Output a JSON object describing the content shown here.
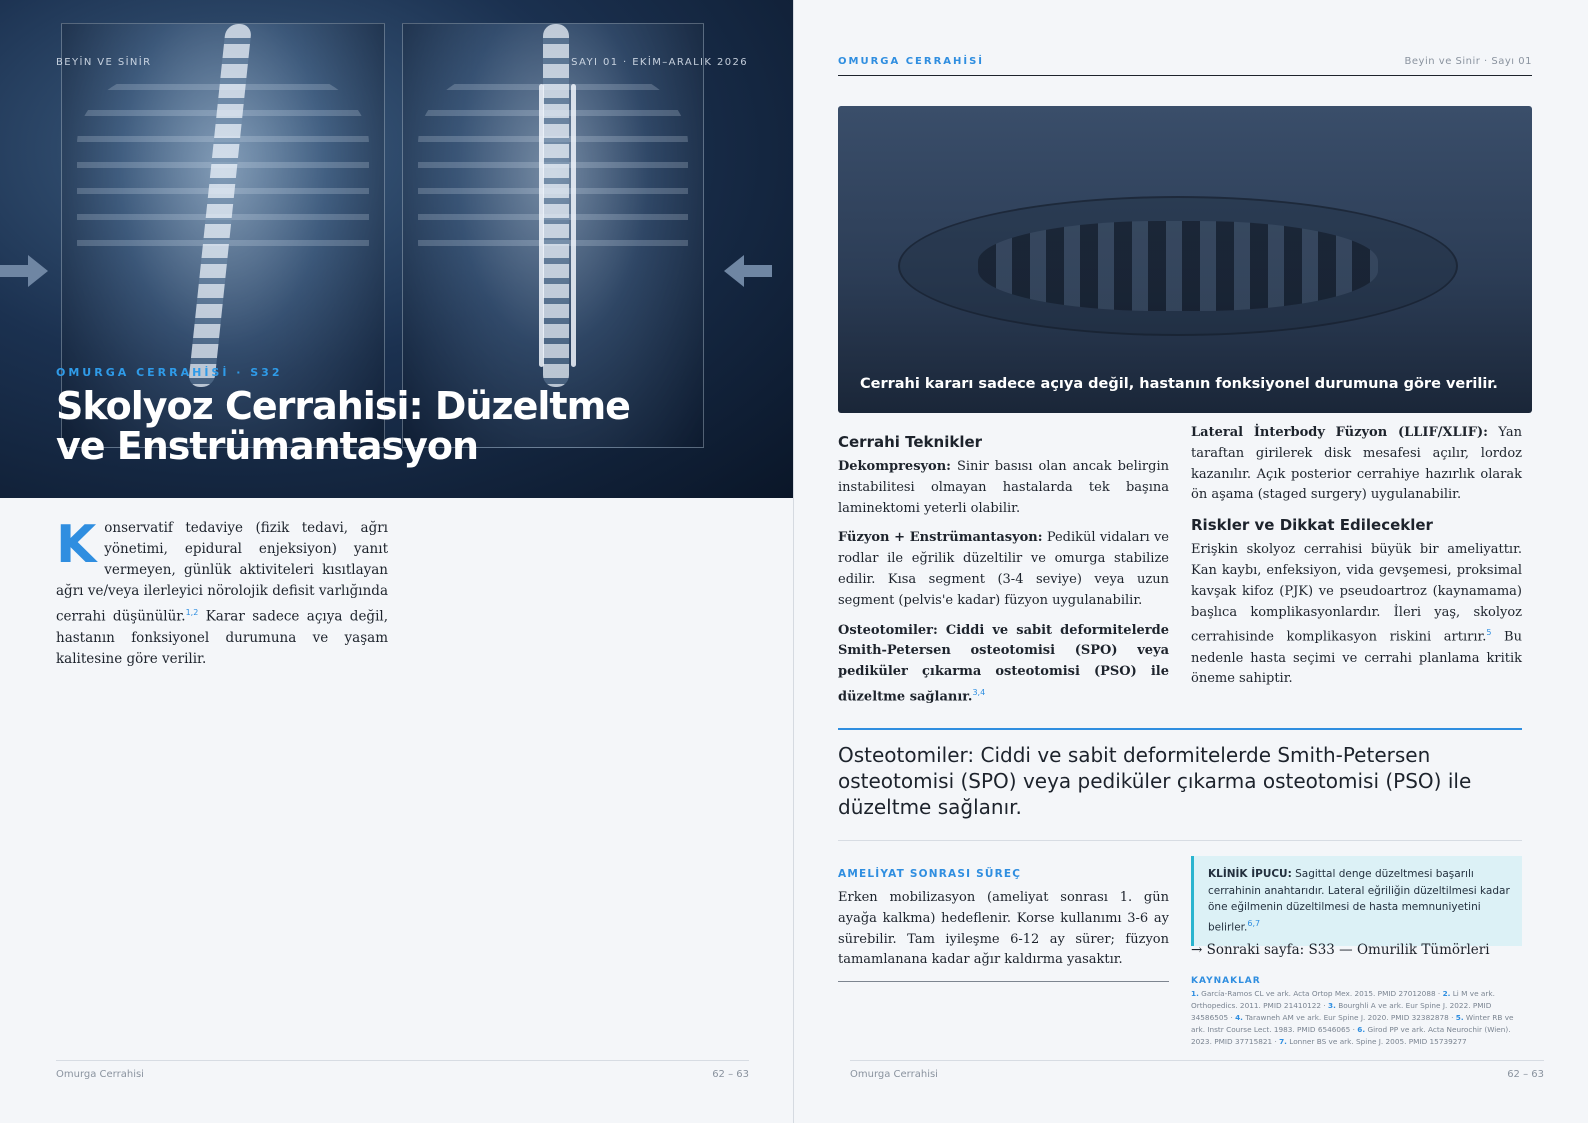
{
  "left": {
    "running_left": "BEYİN VE SİNİR",
    "running_right": "SAYI 01 · EKİM–ARALIK 2026",
    "kicker": "OMURGA CERRAHİSİ · S32",
    "title_line1": "Skolyoz Cerrahisi: Düzeltme",
    "title_line2": "ve Enstrümantasyon",
    "dropcap": "K",
    "intro_a": "onservatif tedaviye (fizik tedavi, ağrı yönetimi, epidural enjeksiyon) yanıt vermeyen, günlük aktiviteleri kısıtlayan ağrı ve/veya ilerleyici nörolojik defisit varlığında cerrahi düşünülür.",
    "intro_sup": "1,2",
    "intro_b": " Karar sadece açıya değil, hastanın fonksiyonel durumuna ve yaşam kalitesine göre verilir.",
    "footer_left": "Omurga Cerrahisi",
    "footer_right": "62 – 63"
  },
  "right": {
    "header_section": "OMURGA CERRAHİSİ",
    "header_mag": "Beyin ve Sinir · Sayı 01",
    "figure_caption": "Cerrahi kararı sadece açıya değil, hastanın fonksiyonel durumuna göre verilir.",
    "techniques_heading": "Cerrahi Teknikler",
    "decomp_label": "Dekompresyon:",
    "decomp_text": " Sinir basısı olan ancak belirgin instabilitesi olmayan hastalarda tek başına laminektomi yeterli olabilir.",
    "fusion_label": "Füzyon + Enstrümantasyon:",
    "fusion_text": " Pedikül vidaları ve rodlar ile eğrilik düzeltilir ve omurga stabilize edilir. Kısa segment (3-4 seviye) veya uzun segment (pelvis'e kadar) füzyon uygulanabilir.",
    "osteo_text": "Osteotomiler: Ciddi ve sabit deformitelerde Smith-Petersen osteotomisi (SPO) veya pediküler çıkarma osteotomisi (PSO) ile düzeltme sağlanır.",
    "osteo_sup": "3,4",
    "llif_label": "Lateral İnterbody Füzyon (LLIF/XLIF):",
    "llif_text": " Yan taraftan girilerek disk mesafesi açılır, lordoz kazanılır. Açık posterior cerrahiye hazırlık olarak ön aşama (staged surgery) uygulanabilir.",
    "risks_heading": "Riskler ve Dikkat Edilecekler",
    "risks_a": "Erişkin skolyoz cerrahisi büyük bir ameliyattır. Kan kaybı, enfeksiyon, vida gevşemesi, proksimal kavşak kifoz (PJK) ve pseudoartroz (kaynamama) başlıca komplikasyonlardır. İleri yaş, skolyoz cerrahisinde komplikasyon riskini artırır.",
    "risks_sup": "5",
    "risks_b": " Bu nedenle hasta seçimi ve cerrahi planlama kritik öneme sahiptir.",
    "pull_quote": "Osteotomiler: Ciddi ve sabit deformitelerde Smith-Petersen osteotomisi (SPO) veya pediküler çıkarma osteotomisi (PSO) ile düzeltme sağlanır.",
    "post_kicker": "AMELİYAT SONRASI SÜREÇ",
    "post_text": "Erken mobilizasyon (ameliyat sonrası 1. gün ayağa kalkma) hedeflenir. Korse kullanımı 3-6 ay sürebilir. Tam iyileşme 6-12 ay sürer; füzyon tamamlanana kadar ağır kaldırma yasaktır.",
    "tip_label": "KLİNİK İPUCU:",
    "tip_text": " Sagittal denge düzeltmesi başarılı cerrahinin anahtarıdır. Lateral eğriliğin düzeltilmesi kadar öne eğilmenin düzeltilmesi de hasta memnuniyetini belirler.",
    "tip_sup": "6,7",
    "next_page": "→ Sonraki sayfa: S33 — Omurilik Tümörleri",
    "refs_heading": "KAYNAKLAR",
    "refs": [
      {
        "n": "1.",
        "t": " García-Ramos CL ve ark. Acta Ortop Mex. 2015. PMID 27012088 · "
      },
      {
        "n": "2.",
        "t": " Li M ve ark. Orthopedics. 2011. PMID 21410122 · "
      },
      {
        "n": "3.",
        "t": " Bourghli A ve ark. Eur Spine J. 2022. PMID 34586505 · "
      },
      {
        "n": "4.",
        "t": " Tarawneh AM ve ark. Eur Spine J. 2020. PMID 32382878 · "
      },
      {
        "n": "5.",
        "t": " Winter RB ve ark. Instr Course Lect. 1983. PMID 6546065 · "
      },
      {
        "n": "6.",
        "t": " Girod PP ve ark. Acta Neurochir (Wien). 2023. PMID 37715821 · "
      },
      {
        "n": "7.",
        "t": " Lonner BS ve ark. Spine J. 2005. PMID 15739277"
      }
    ],
    "footer_left": "Omurga Cerrahisi",
    "footer_right": "62 – 63"
  }
}
